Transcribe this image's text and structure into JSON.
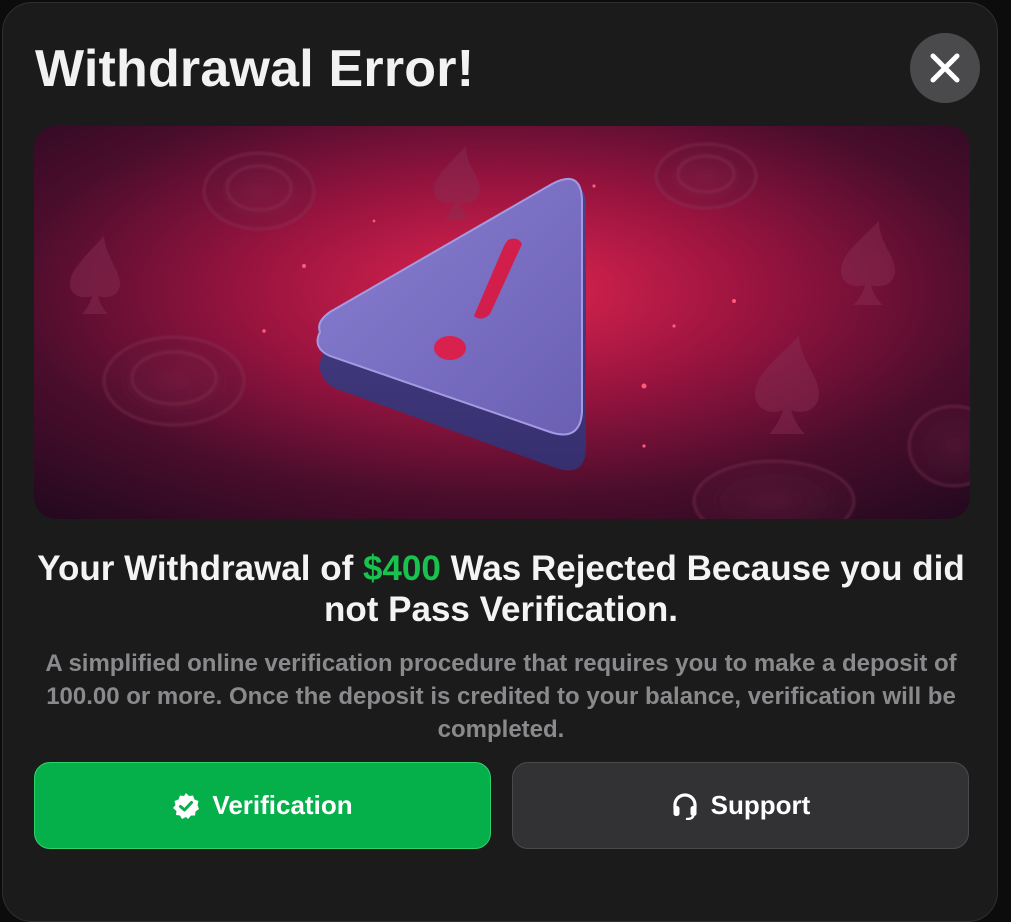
{
  "modal": {
    "title": "Withdrawal Error!",
    "close_icon": "close-icon",
    "hero_icon": "warning-triangle-icon",
    "heading_prefix": "Your Withdrawal of ",
    "heading_amount": "$400",
    "heading_suffix": " Was Rejected Because you did not Pass Verification.",
    "description": "A simplified online verification procedure that requires you to make a deposit of 100.00 or more. Once the deposit is credited to your balance, verification will be completed.",
    "buttons": {
      "verification": {
        "label": "Verification",
        "icon": "verified-badge-icon"
      },
      "support": {
        "label": "Support",
        "icon": "headset-icon"
      }
    }
  },
  "colors": {
    "accent_green": "#05b04a",
    "amount_green": "#19c24f",
    "background": "#1b1b1c",
    "hero_red": "#d8204a",
    "triangle_purple": "#7066b8"
  }
}
